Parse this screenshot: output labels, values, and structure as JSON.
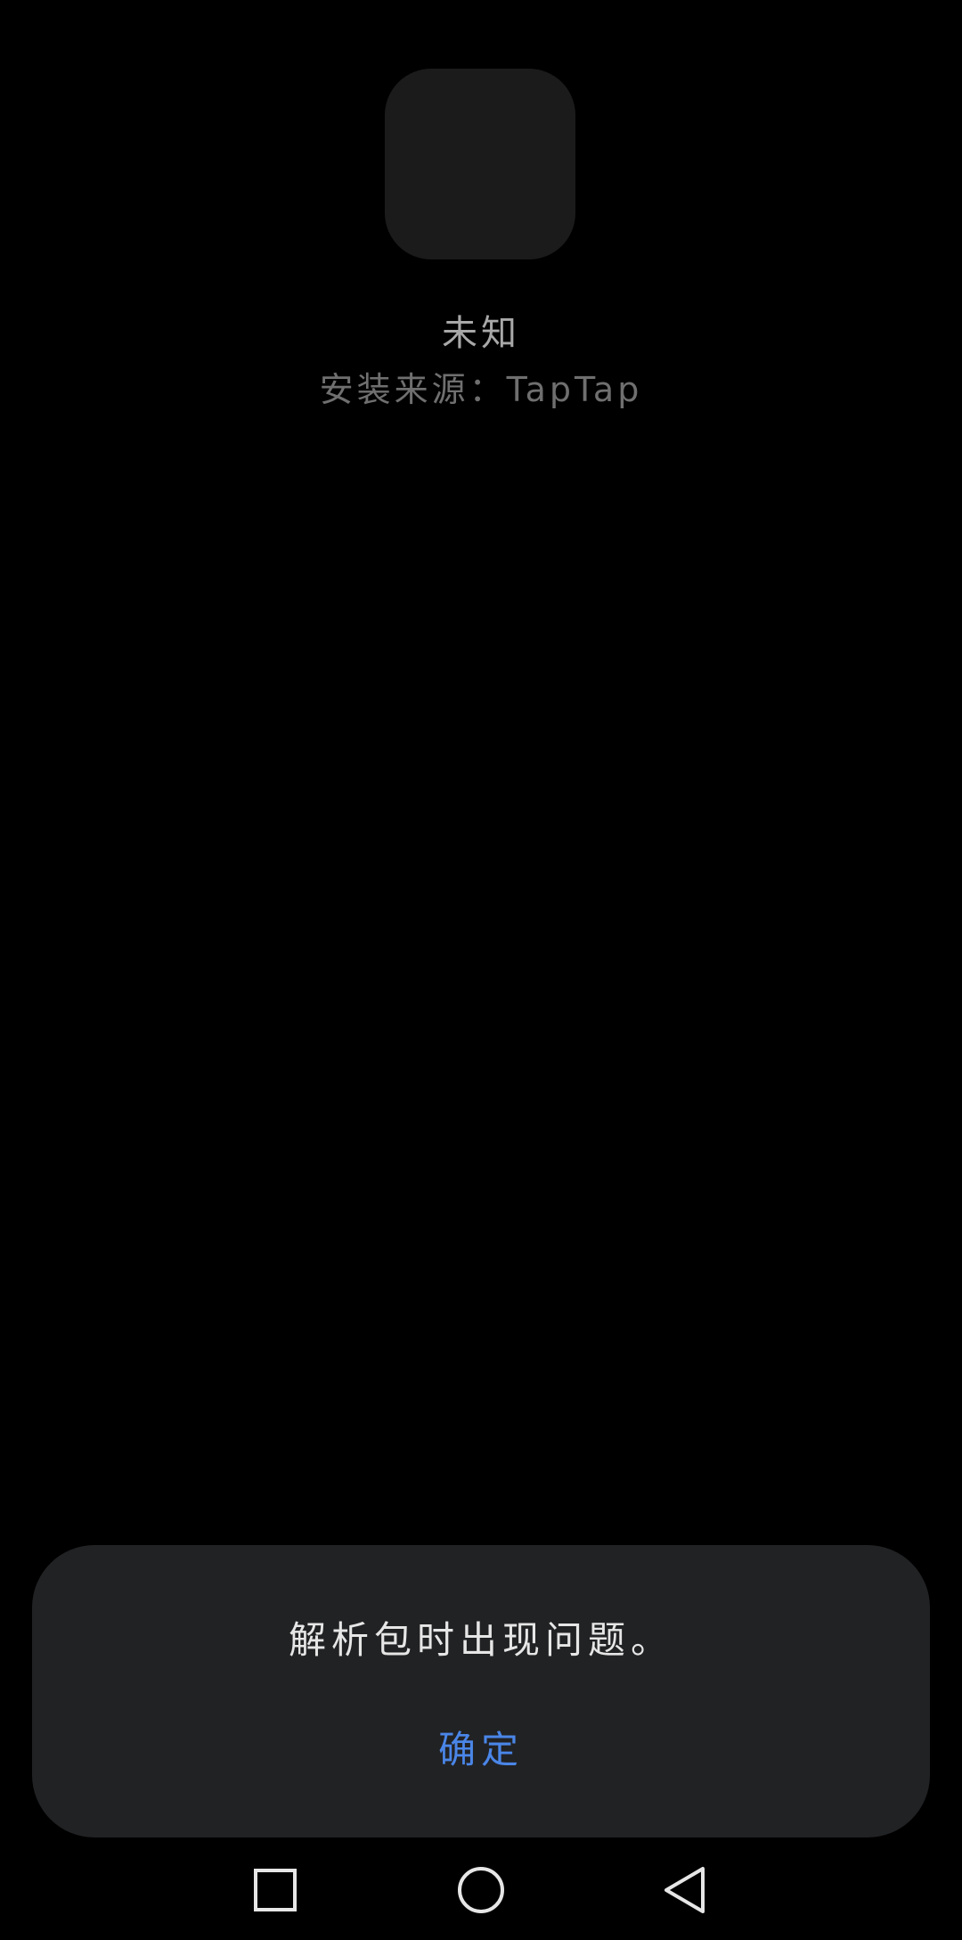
{
  "app": {
    "name": "未知",
    "install_source": "安装来源：TapTap"
  },
  "dialog": {
    "message": "解析包时出现问题。",
    "confirm_label": "确定"
  },
  "colors": {
    "background": "#000000",
    "icon_placeholder": "#1b1b1b",
    "dialog_background": "#212224",
    "accent": "#4a86e8"
  },
  "navbar": {
    "recents_icon": "square-icon",
    "home_icon": "circle-icon",
    "back_icon": "triangle-back-icon"
  }
}
